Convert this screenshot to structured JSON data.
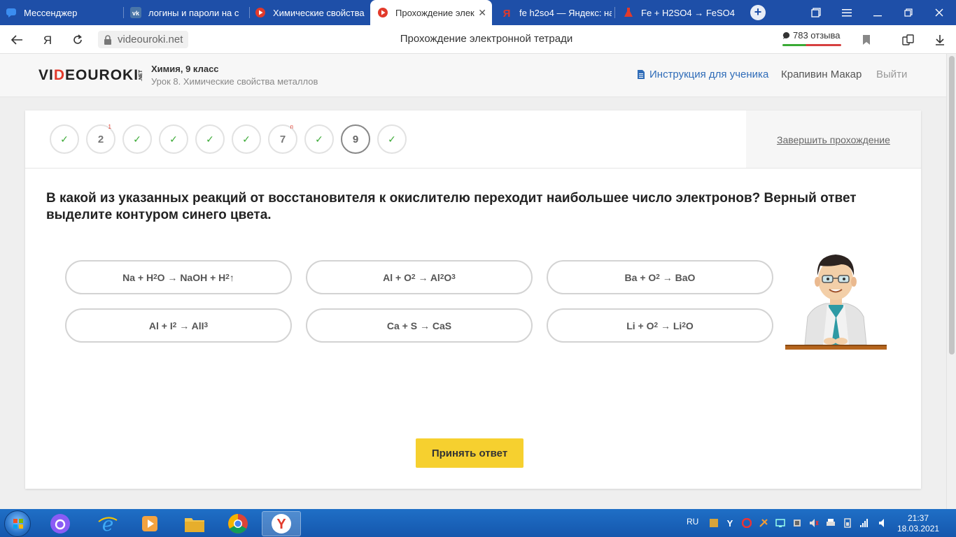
{
  "browser": {
    "tabs": [
      {
        "label": "Мессенджер",
        "icon": "messenger-icon"
      },
      {
        "label": "логины и пароли на с",
        "icon": "vk-icon"
      },
      {
        "label": "Химические свойства",
        "icon": "videouroki-icon"
      },
      {
        "label": "Прохождение элек",
        "icon": "videouroki-icon",
        "active": true
      },
      {
        "label": "fe h2so4 — Яндекс: на",
        "icon": "yandex-icon"
      },
      {
        "label": "Fe + H2SO4 → FeSO4",
        "icon": "flask-icon"
      }
    ],
    "url": "videouroki.net",
    "page_title": "Прохождение электронной тетради",
    "reviews": "783 отзыва"
  },
  "header": {
    "logo_parts": [
      "VI",
      "D",
      "EOUROKI",
      ".NET"
    ],
    "course": "Химия, 9 класс",
    "lesson": "Урок 8. Химические свойства металлов",
    "instruction_link": "Инструкция для ученика",
    "user_name": "Крапивин Макар",
    "logout": "Выйти"
  },
  "steps": [
    {
      "label": "✓",
      "state": "done"
    },
    {
      "label": "2",
      "state": "pending",
      "sup": "1"
    },
    {
      "label": "✓",
      "state": "done"
    },
    {
      "label": "✓",
      "state": "done"
    },
    {
      "label": "✓",
      "state": "done"
    },
    {
      "label": "✓",
      "state": "done"
    },
    {
      "label": "7",
      "state": "pending",
      "sup": "п"
    },
    {
      "label": "✓",
      "state": "done"
    },
    {
      "label": "9",
      "state": "current"
    },
    {
      "label": "✓",
      "state": "done"
    }
  ],
  "finish_link": "Завершить прохождение",
  "question": "В какой из указанных реакций от восстановителя к окислителю переходит наибольшее число электронов? Верный ответ выделите контуром синего цвета.",
  "answers": [
    {
      "parts": [
        "Na + H",
        "2",
        "O → NaOH + H",
        "2",
        "↑"
      ]
    },
    {
      "parts": [
        "Al + O",
        "2",
        " → Al",
        "2",
        "O",
        "3"
      ]
    },
    {
      "parts": [
        "Ba + O",
        "2",
        " → BaO"
      ]
    },
    {
      "parts": [
        "Al + I",
        "2",
        " → AlI",
        "3"
      ]
    },
    {
      "parts": [
        "Ca + S → CaS"
      ]
    },
    {
      "parts": [
        "Li + O",
        "2",
        " → Li",
        "2",
        "O"
      ]
    }
  ],
  "submit_label": "Принять ответ",
  "taskbar": {
    "lang": "RU",
    "time": "21:37",
    "date": "18.03.2021"
  },
  "colors": {
    "browser_tabstrip": "#1e4fa8",
    "check_green": "#3aaa35",
    "submit_yellow": "#f6d02f",
    "link_blue": "#2f6cb8",
    "logo_red": "#e23a2b"
  }
}
